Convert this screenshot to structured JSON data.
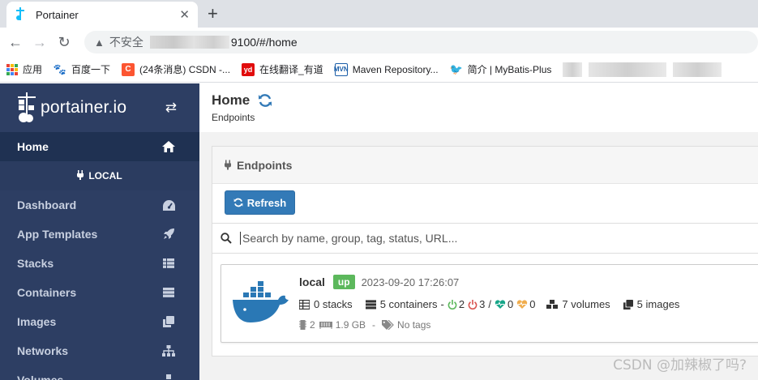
{
  "browser": {
    "tab_title": "Portainer",
    "tab_close": "✕",
    "new_tab": "+",
    "security_label": "不安全",
    "url_visible": "9100/#/home",
    "bookmarks": [
      {
        "label": "应用"
      },
      {
        "label": "百度一下"
      },
      {
        "label": "(24条消息) CSDN -..."
      },
      {
        "label": "在线翻译_有道"
      },
      {
        "label": "Maven Repository..."
      },
      {
        "label": "简介 | MyBatis-Plus"
      }
    ]
  },
  "sidebar": {
    "brand": "portainer.io",
    "home_label": "Home",
    "endpoint_label": "LOCAL",
    "items": [
      {
        "label": "Dashboard",
        "icon": "tachometer-icon"
      },
      {
        "label": "App Templates",
        "icon": "rocket-icon"
      },
      {
        "label": "Stacks",
        "icon": "th-list-icon"
      },
      {
        "label": "Containers",
        "icon": "server-icon"
      },
      {
        "label": "Images",
        "icon": "clone-icon"
      },
      {
        "label": "Networks",
        "icon": "sitemap-icon"
      },
      {
        "label": "Volumes",
        "icon": "cubes-icon"
      }
    ]
  },
  "header": {
    "title": "Home",
    "breadcrumb": "Endpoints"
  },
  "endpoints": {
    "widget_title": "Endpoints",
    "refresh_label": "Refresh",
    "search_placeholder": "Search by name, group, tag, status, URL...",
    "card": {
      "name": "local",
      "status": "up",
      "timestamp": "2023-09-20 17:26:07",
      "stacks": "0 stacks",
      "containers": "5 containers",
      "sep1": "-",
      "running": "2",
      "stopped": "3",
      "slash": "/",
      "healthy": "0",
      "unhealthy": "0",
      "volumes": "7 volumes",
      "images": "5 images",
      "cpu": "2",
      "memory": "1.9 GB",
      "sep2": "-",
      "tags": "No tags"
    }
  },
  "watermark": "CSDN @加辣椒了吗?",
  "colors": {
    "sidebar_bg": "#2d3e63",
    "primary_button": "#337ab7",
    "status_up": "#5cb85c",
    "running": "#5cb85c",
    "stopped": "#d9534f",
    "healthy": "#18a689",
    "unhealthy": "#f0ad4e"
  }
}
